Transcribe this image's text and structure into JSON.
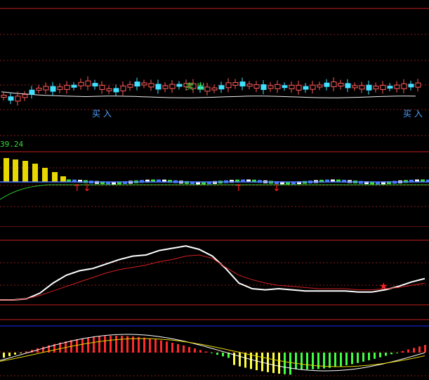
{
  "colors": {
    "background": "#000000",
    "separator": "#c81e1e",
    "grid": "#8b1a1a",
    "axis_blue": "#1e2cff",
    "price_line": "#f0f0f0",
    "buy": "#4ea3ff",
    "sell": "#33dd33",
    "value": "#33dd33",
    "white_line": "#ffffff",
    "red_line": "#d42020",
    "star": "#ff2020",
    "macd_up": "#ff2a2a",
    "macd_down": "#ffff40",
    "macd_pink": "#ff40ff",
    "macd_green": "#40ff40"
  },
  "panel1": {
    "sell_label": "卖 出",
    "buy_labels": [
      "买 入",
      "买 入"
    ]
  },
  "panel2": {
    "value_text": "39.24",
    "signals": [
      "↑",
      "↓",
      "↑",
      "↓"
    ]
  },
  "chart_data": {
    "type": "line",
    "title": "",
    "series": [
      {
        "values": [
          0.3,
          0.3,
          0.31,
          0.36,
          0.45,
          0.52,
          0.56,
          0.58,
          0.62,
          0.66,
          0.69,
          0.7,
          0.74,
          0.76,
          0.78,
          0.75,
          0.69,
          0.58,
          0.45,
          0.4,
          0.39,
          0.4,
          0.39,
          0.38,
          0.38,
          0.38,
          0.38,
          0.37,
          0.37,
          0.39,
          0.42,
          0.46,
          0.49
        ]
      },
      {
        "values": [
          0.3,
          0.3,
          0.31,
          0.34,
          0.38,
          0.42,
          0.46,
          0.5,
          0.54,
          0.57,
          0.59,
          0.61,
          0.64,
          0.66,
          0.69,
          0.7,
          0.67,
          0.59,
          0.52,
          0.48,
          0.45,
          0.43,
          0.42,
          0.41,
          0.4,
          0.4,
          0.4,
          0.39,
          0.39,
          0.4,
          0.41,
          0.43,
          0.45
        ]
      }
    ]
  }
}
